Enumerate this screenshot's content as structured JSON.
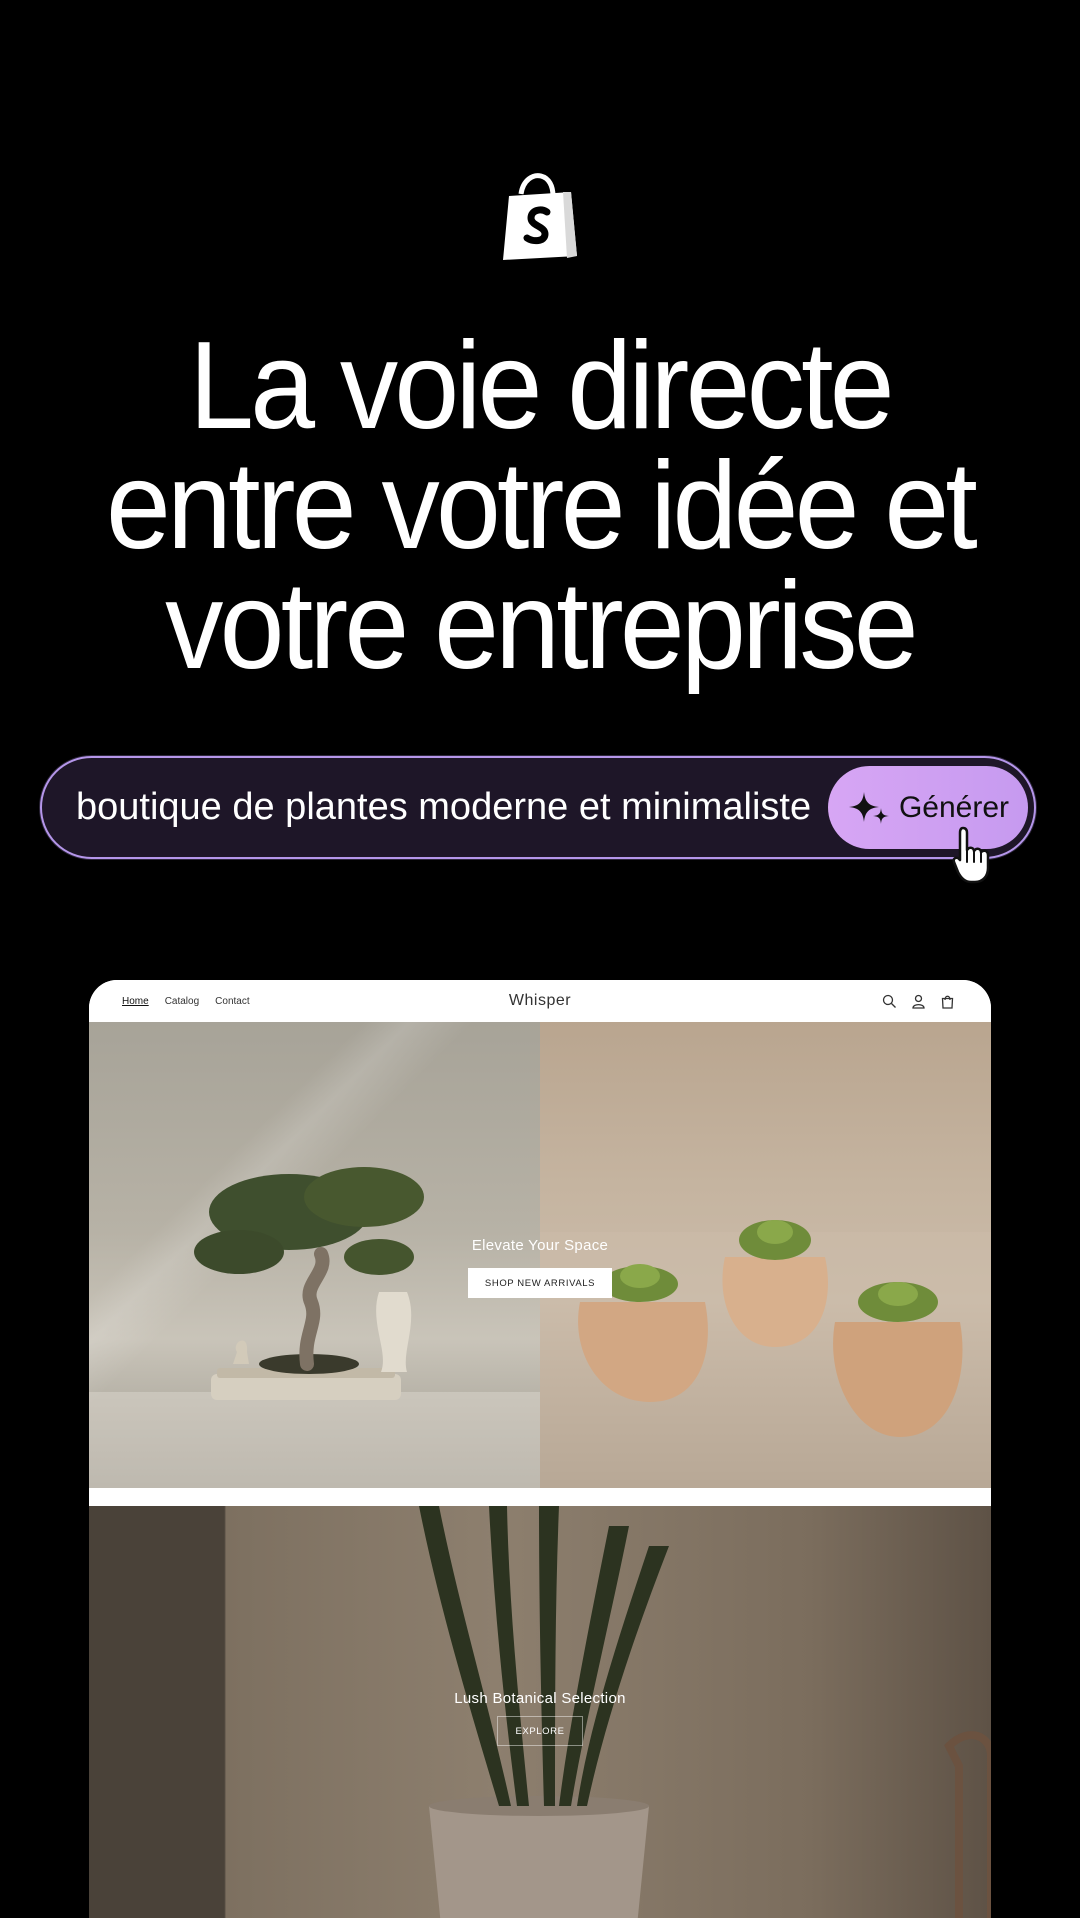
{
  "headline": {
    "line1": "La voie directe",
    "line2": "entre votre idée et",
    "line3": "votre entreprise"
  },
  "prompt": {
    "text": "boutique de plantes moderne et minimaliste",
    "button_label": "Générer"
  },
  "store": {
    "name": "Whisper",
    "nav": [
      "Home",
      "Catalog",
      "Contact"
    ],
    "hero": {
      "title": "Elevate Your Space",
      "button": "SHOP NEW ARRIVALS"
    },
    "section2": {
      "title": "Lush Botanical Selection",
      "button": "EXPLORE"
    }
  },
  "icons": {
    "logo": "shopify-bag-icon",
    "generate": "sparkles-icon",
    "cursor": "hand-pointer-icon",
    "search": "search-icon",
    "account": "user-icon",
    "cart": "bag-icon"
  },
  "colors": {
    "background": "#000000",
    "prompt_border": "#b596ea",
    "prompt_fill": "#1e1628",
    "button_fill": "#d2a4f3"
  }
}
